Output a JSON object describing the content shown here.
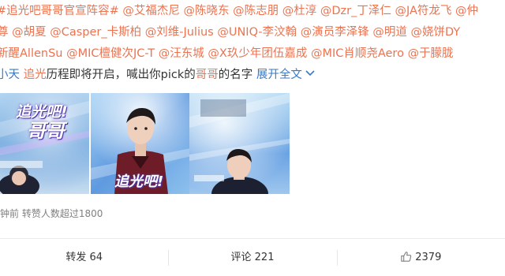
{
  "post": {
    "line1": {
      "topic": "#追光吧哥哥官宣阵容#",
      "mentions": [
        "@艾福杰尼",
        "@陈晓东",
        "@陈志朋",
        "@杜淳",
        "@Dzr_丁泽仁",
        "@JA符龙飞",
        "@仲"
      ]
    },
    "line2": {
      "prefix": "尊",
      "mentions": [
        "@胡夏",
        "@Casper_卡斯柏",
        "@刘维-Julius",
        "@UNIQ-李汶翰",
        "@演员李泽锋",
        "@明道",
        "@娆饼DY"
      ]
    },
    "line3": {
      "prefix": "新醒AllenSu",
      "mentions": [
        "@MIC檀健次JC-T",
        "@汪东城",
        "@X玖少年团伍嘉成",
        "@MIC肖顺尧Aero",
        "@于朦胧"
      ]
    },
    "line4": {
      "prefix": "小天 ",
      "keyword1": "追光",
      "text1": "历程即将开启，喊出你pick的",
      "keyword2": "哥哥",
      "text2": "的名字 ",
      "expand": "展开全文",
      "expand_icon": "chevron-down-icon"
    },
    "images": [
      {
        "caption_top": "追光吧!",
        "caption_bottom": "哥哥"
      },
      {
        "caption_top": "追光吧!",
        "caption_bottom": ""
      },
      {
        "caption_top": "",
        "caption_bottom": ""
      }
    ],
    "meta": "钟前 转赞人数超过1800"
  },
  "actions": {
    "repost": "转发 64",
    "comment": "评论 221",
    "like": "2379",
    "like_icon": "thumbs-up-icon"
  },
  "colors": {
    "link": "#eb7350",
    "blue": "#3b79c6",
    "text": "#333333",
    "meta": "#808080"
  }
}
